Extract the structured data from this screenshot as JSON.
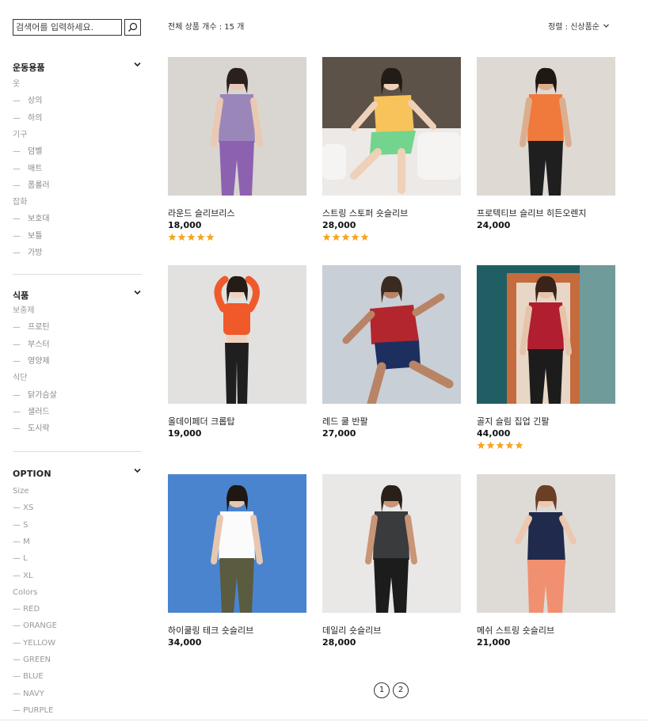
{
  "search": {
    "placeholder": "검색어를 입력하세요."
  },
  "sidebar": {
    "sports": {
      "title": "운동용품",
      "items": [
        {
          "type": "group",
          "label": "옷"
        },
        {
          "type": "sub",
          "label": "상의"
        },
        {
          "type": "sub",
          "label": "하의"
        },
        {
          "type": "group",
          "label": "기구"
        },
        {
          "type": "sub",
          "label": "덤벨"
        },
        {
          "type": "sub",
          "label": "매트"
        },
        {
          "type": "sub",
          "label": "폼롤러"
        },
        {
          "type": "group",
          "label": "잡화"
        },
        {
          "type": "sub",
          "label": "보호대"
        },
        {
          "type": "sub",
          "label": "보틀"
        },
        {
          "type": "sub",
          "label": "가방"
        }
      ]
    },
    "food": {
      "title": "식품",
      "items": [
        {
          "type": "group",
          "label": "보충제"
        },
        {
          "type": "sub",
          "label": "프로틴"
        },
        {
          "type": "sub",
          "label": "부스터"
        },
        {
          "type": "sub",
          "label": "영양제"
        },
        {
          "type": "group",
          "label": "식단"
        },
        {
          "type": "sub",
          "label": "닭가슴살"
        },
        {
          "type": "sub",
          "label": "샐러드"
        },
        {
          "type": "sub",
          "label": "도시락"
        }
      ]
    },
    "option": {
      "title": "OPTION",
      "items": [
        {
          "type": "group",
          "label": "Size"
        },
        {
          "type": "opt",
          "label": "— XS"
        },
        {
          "type": "opt",
          "label": "— S"
        },
        {
          "type": "opt",
          "label": "— M"
        },
        {
          "type": "opt",
          "label": "— L"
        },
        {
          "type": "opt",
          "label": "— XL"
        },
        {
          "type": "group",
          "label": "Colors"
        },
        {
          "type": "opt",
          "label": "— RED"
        },
        {
          "type": "opt",
          "label": "— ORANGE"
        },
        {
          "type": "opt",
          "label": "— YELLOW"
        },
        {
          "type": "opt",
          "label": "— GREEN"
        },
        {
          "type": "opt",
          "label": "— BLUE"
        },
        {
          "type": "opt",
          "label": "— NAVY"
        },
        {
          "type": "opt",
          "label": "— PURPLE"
        }
      ]
    }
  },
  "header": {
    "total_label": "전체 상품 개수 : 15 개",
    "sort_label": "정렬 : 신상품순"
  },
  "products": [
    {
      "name": "라운드 슬리브리스",
      "price": "18,000",
      "rating": 5
    },
    {
      "name": "스트링 스토퍼 숏슬리브",
      "price": "28,000",
      "rating": 5
    },
    {
      "name": "프로텍티브 슬리브 히든오렌지",
      "price": "24,000",
      "rating": 0
    },
    {
      "name": "올데이페더 크롭탑",
      "price": "19,000",
      "rating": 0
    },
    {
      "name": "레드 쿨 반팔",
      "price": "27,000",
      "rating": 0
    },
    {
      "name": "골지 슬림 집업 긴팔",
      "price": "44,000",
      "rating": 5
    },
    {
      "name": "하이쿨링 테크 숏슬리브",
      "price": "34,000",
      "rating": 0
    },
    {
      "name": "데일리 숏슬리브",
      "price": "28,000",
      "rating": 0
    },
    {
      "name": "메쉬 스트링 숏슬리브",
      "price": "21,000",
      "rating": 0
    }
  ],
  "pagination": {
    "pages": [
      "1",
      "2"
    ]
  },
  "colors": {
    "star": "#f5a623",
    "divider": "#dddddd"
  }
}
